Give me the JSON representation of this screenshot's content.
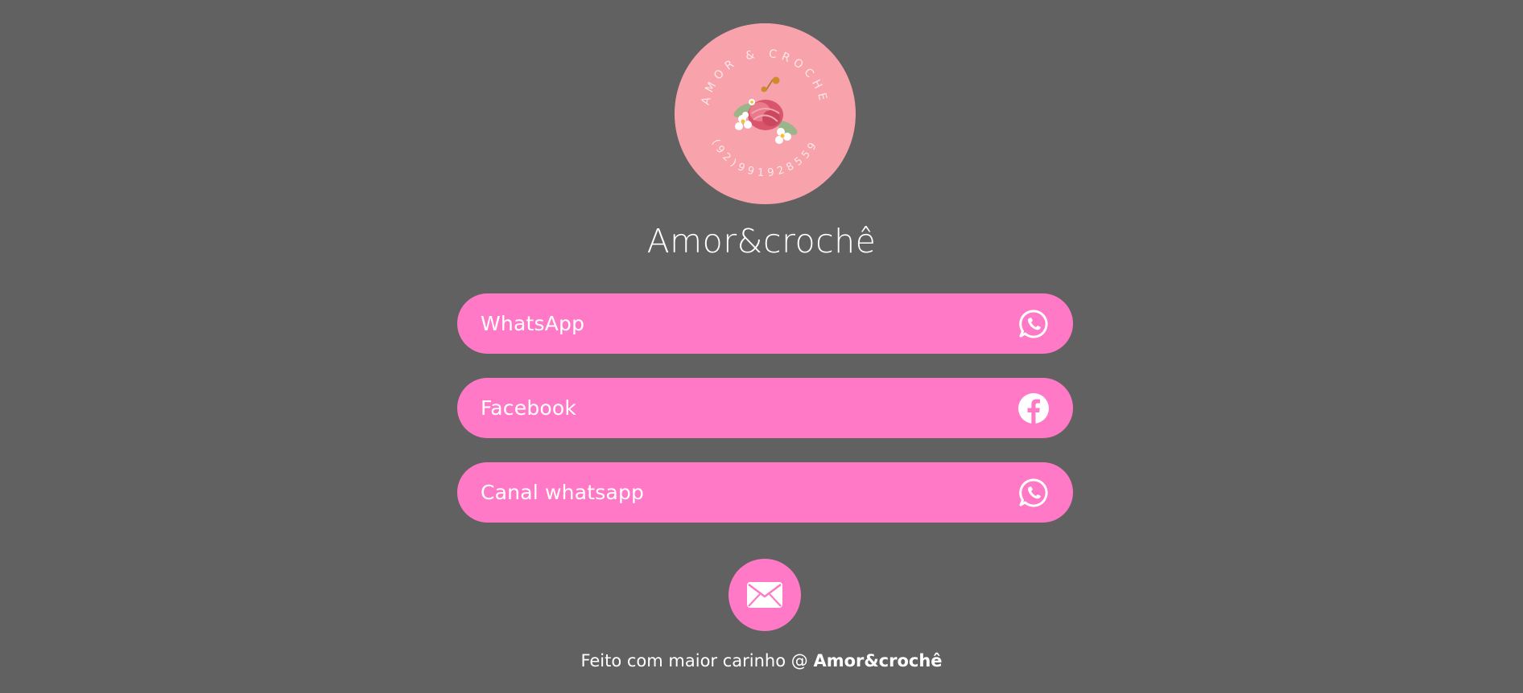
{
  "colors": {
    "background": "#616161",
    "button": "#ff79c6",
    "logo_background": "#f8a3ab",
    "text": "#ffffff"
  },
  "logo": {
    "ring_text_top": "AMOR & CROCHE",
    "ring_text_bottom": "(92)991928559"
  },
  "profile": {
    "name": "Amor&crochê"
  },
  "links": [
    {
      "label": "WhatsApp",
      "icon": "whatsapp-icon"
    },
    {
      "label": "Facebook",
      "icon": "facebook-icon"
    },
    {
      "label": "Canal whatsapp",
      "icon": "whatsapp-icon"
    }
  ],
  "email": {
    "icon": "envelope-icon"
  },
  "footer": {
    "text": "Feito com maior carinho @ ",
    "brand": "Amor&crochê"
  }
}
